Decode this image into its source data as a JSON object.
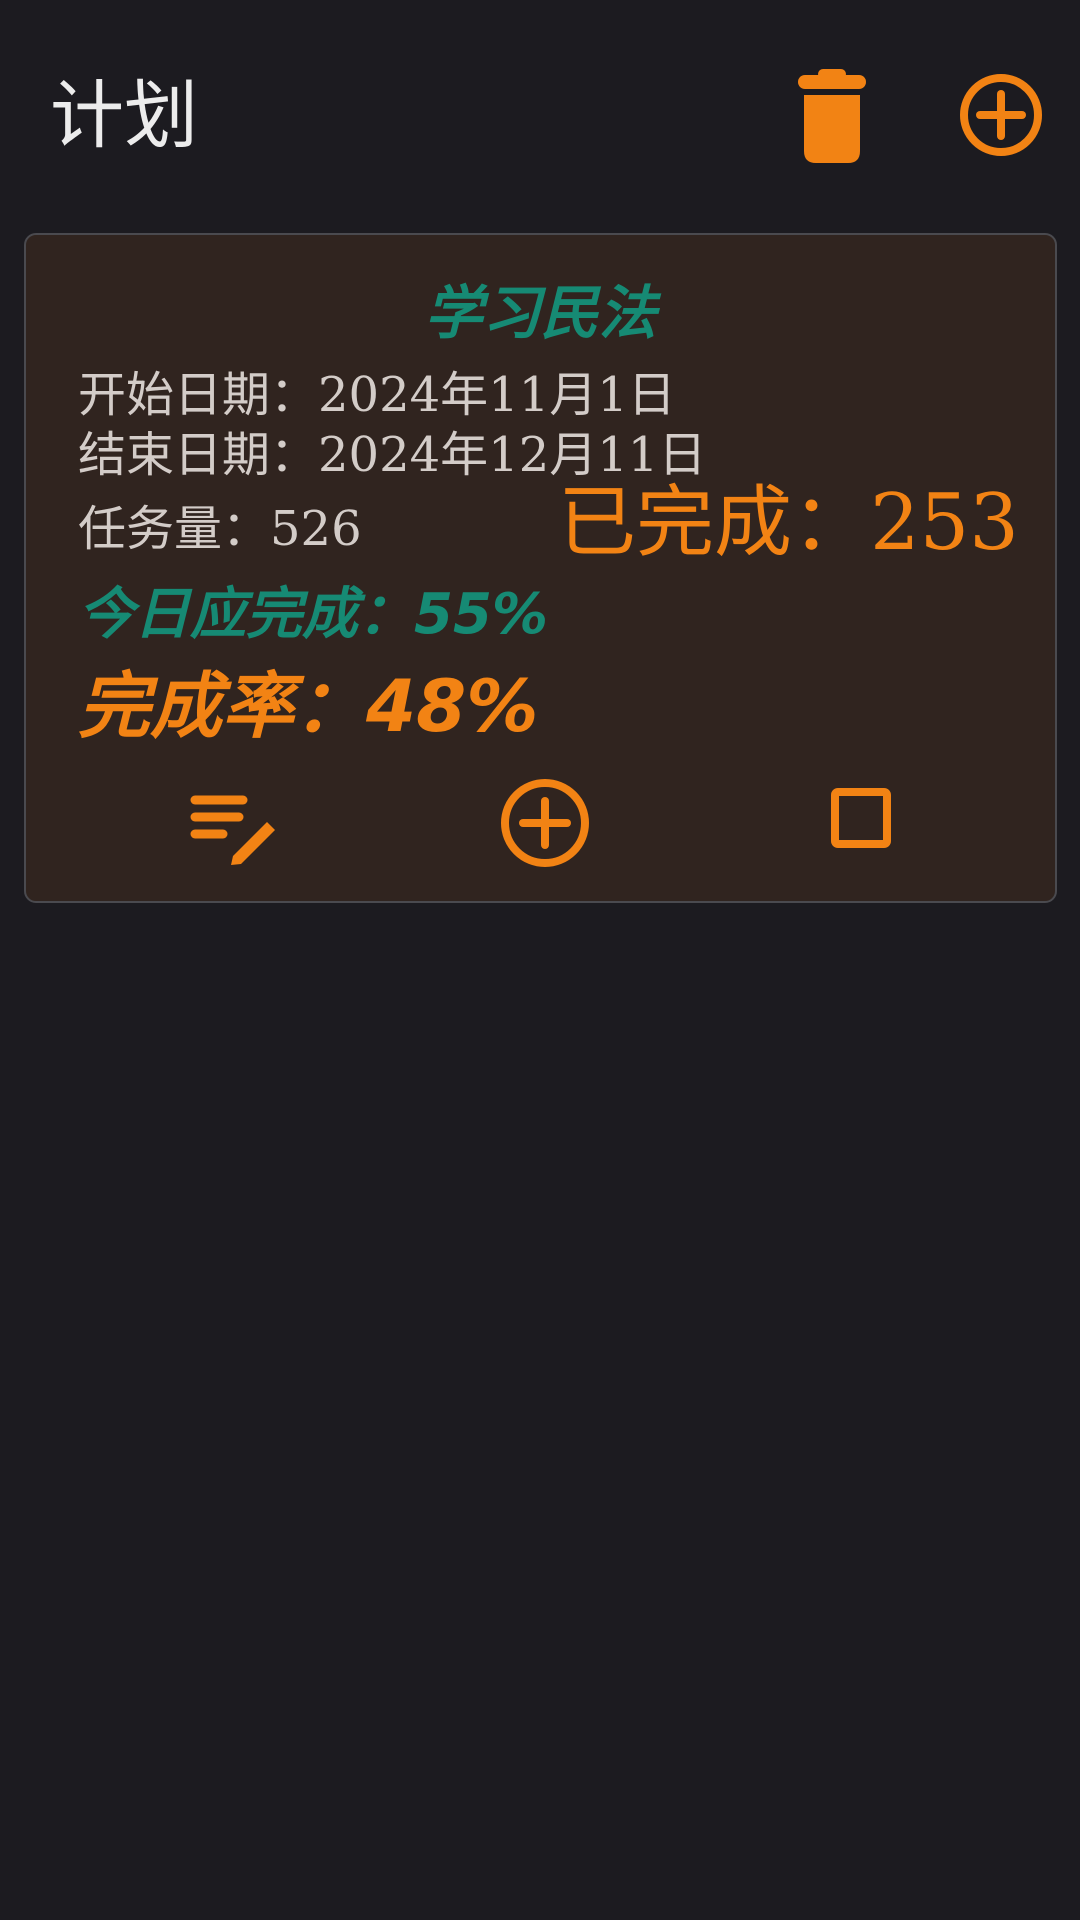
{
  "header": {
    "title": "计划",
    "actions": {
      "delete_icon": "trash-icon",
      "add_icon": "add-circle-icon"
    }
  },
  "colors": {
    "background": "#1c1b20",
    "card": "#30241f",
    "accent": "#f28314",
    "teal": "#168a74",
    "text": "#d3ccc8"
  },
  "plan": {
    "title": "学习民法",
    "start": {
      "label": "开始日期：",
      "value": "2024年11月1日"
    },
    "end": {
      "label": "结束日期：",
      "value": "2024年12月11日"
    },
    "task_amount": {
      "label": "任务量：",
      "value": "526"
    },
    "completed": {
      "label": "已完成：",
      "value": "253"
    },
    "today_target": {
      "label": "今日应完成：",
      "value": "55%"
    },
    "completion_rate": {
      "label": "完成率：",
      "value": "48%"
    },
    "actions": {
      "edit_icon": "edit-list-icon",
      "add_icon": "add-circle-icon",
      "checkbox_icon": "checkbox-icon"
    }
  }
}
